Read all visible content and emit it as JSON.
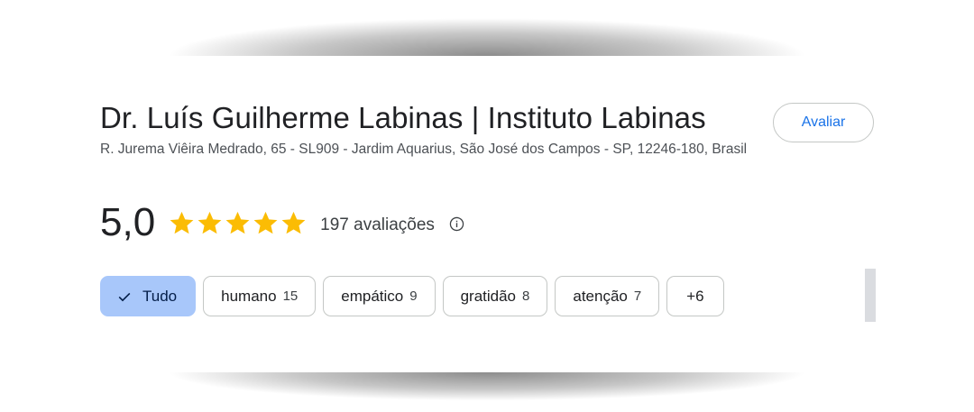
{
  "place": {
    "title": "Dr. Luís Guilherme Labinas | Instituto Labinas",
    "address": "R. Jurema Viêira Medrado, 65 - SL909 - Jardim Aquarius, São José dos Campos - SP, 12246-180, Brasil",
    "review_button_label": "Avaliar"
  },
  "rating": {
    "value": "5,0",
    "stars": 5,
    "star_color": "#fbbc04",
    "reviews_label": "197 avaliações",
    "info_icon": "info-icon"
  },
  "chips": [
    {
      "label": "Tudo",
      "count": "",
      "selected": true,
      "icon": "check-icon"
    },
    {
      "label": "humano",
      "count": "15",
      "selected": false
    },
    {
      "label": "empático",
      "count": "9",
      "selected": false
    },
    {
      "label": "gratidão",
      "count": "8",
      "selected": false
    },
    {
      "label": "atenção",
      "count": "7",
      "selected": false
    },
    {
      "label": "+6",
      "count": "",
      "selected": false
    }
  ],
  "colors": {
    "accent": "#1a73e8",
    "selected_chip_bg": "#a8c7fa",
    "text_primary": "#202124",
    "text_secondary": "#4d5156"
  }
}
